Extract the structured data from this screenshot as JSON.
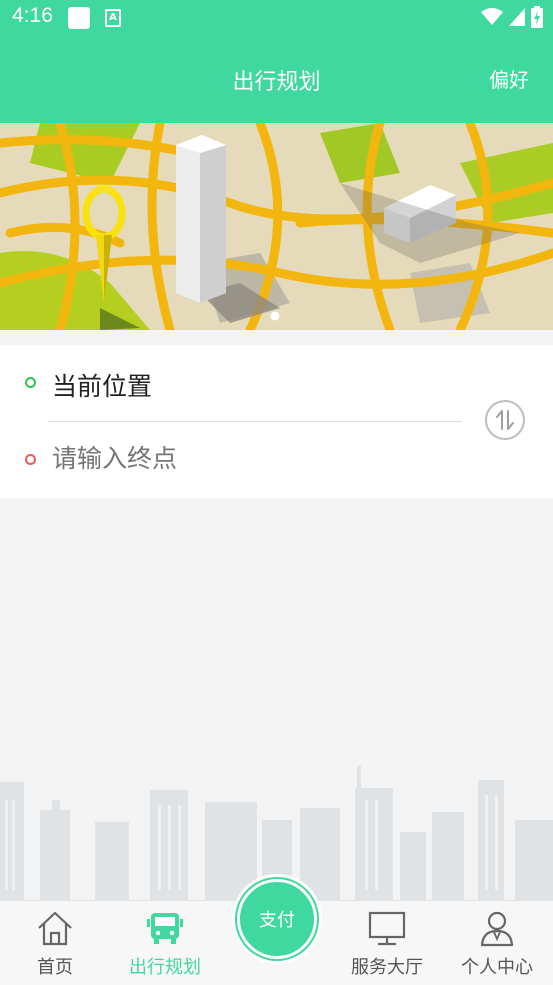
{
  "status_bar": {
    "time": "4:16"
  },
  "header": {
    "title": "出行规划",
    "action_label": "偏好"
  },
  "route": {
    "start_label": "当前位置",
    "end_placeholder": "请输入终点"
  },
  "bottom_nav": {
    "items": [
      {
        "label": "首页",
        "icon": "home-icon"
      },
      {
        "label": "出行规划",
        "icon": "bus-icon",
        "active": true
      },
      {
        "label": "服务大厅",
        "icon": "monitor-icon"
      },
      {
        "label": "个人中心",
        "icon": "user-icon"
      }
    ],
    "center_button_label": "支付"
  },
  "colors": {
    "accent": "#3fd89f",
    "start_dot": "#29c74a",
    "end_dot": "#ee5a5a"
  }
}
